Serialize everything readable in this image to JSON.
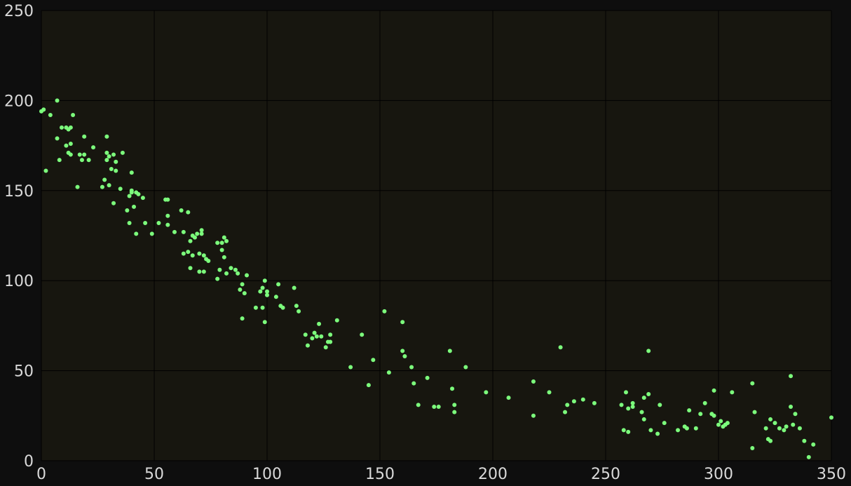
{
  "chart_data": {
    "type": "scatter",
    "title": "",
    "xlabel": "",
    "ylabel": "",
    "xlim": [
      0,
      350
    ],
    "ylim": [
      0,
      250
    ],
    "xticks": [
      0,
      50,
      100,
      150,
      200,
      250,
      300,
      350
    ],
    "yticks": [
      0,
      50,
      100,
      150,
      200,
      250
    ],
    "grid": true,
    "colors": {
      "page_background": "#0e0e0e",
      "plot_background": "#17160f",
      "grid": "#000000",
      "points": "#7cfc7c",
      "tick_labels": "#d9d9d9"
    },
    "series": [
      {
        "points": [
          [
            0,
            194
          ],
          [
            1,
            195
          ],
          [
            2,
            161
          ],
          [
            4,
            192
          ],
          [
            7,
            179
          ],
          [
            7,
            200
          ],
          [
            8,
            167
          ],
          [
            9,
            185
          ],
          [
            11,
            185
          ],
          [
            11,
            175
          ],
          [
            12,
            184
          ],
          [
            12,
            171
          ],
          [
            13,
            176
          ],
          [
            13,
            170
          ],
          [
            13,
            185
          ],
          [
            14,
            192
          ],
          [
            16,
            152
          ],
          [
            17,
            170
          ],
          [
            18,
            167
          ],
          [
            19,
            170
          ],
          [
            19,
            180
          ],
          [
            21,
            167
          ],
          [
            23,
            174
          ],
          [
            27,
            152
          ],
          [
            28,
            156
          ],
          [
            29,
            171
          ],
          [
            29,
            180
          ],
          [
            29,
            167
          ],
          [
            30,
            169
          ],
          [
            30,
            153
          ],
          [
            31,
            162
          ],
          [
            32,
            143
          ],
          [
            32,
            170
          ],
          [
            33,
            161
          ],
          [
            33,
            166
          ],
          [
            35,
            151
          ],
          [
            36,
            171
          ],
          [
            38,
            139
          ],
          [
            39,
            132
          ],
          [
            39,
            147
          ],
          [
            40,
            149
          ],
          [
            40,
            160
          ],
          [
            40,
            150
          ],
          [
            41,
            141
          ],
          [
            42,
            126
          ],
          [
            42,
            149
          ],
          [
            43,
            148
          ],
          [
            45,
            146
          ],
          [
            46,
            132
          ],
          [
            49,
            126
          ],
          [
            52,
            132
          ],
          [
            55,
            145
          ],
          [
            56,
            145
          ],
          [
            56,
            136
          ],
          [
            56,
            131
          ],
          [
            59,
            127
          ],
          [
            62,
            139
          ],
          [
            63,
            127
          ],
          [
            63,
            115
          ],
          [
            65,
            138
          ],
          [
            65,
            116
          ],
          [
            66,
            107
          ],
          [
            66,
            122
          ],
          [
            67,
            125
          ],
          [
            67,
            114
          ],
          [
            68,
            124
          ],
          [
            69,
            126
          ],
          [
            70,
            115
          ],
          [
            70,
            105
          ],
          [
            71,
            128
          ],
          [
            71,
            126
          ],
          [
            72,
            105
          ],
          [
            72,
            114
          ],
          [
            73,
            112
          ],
          [
            74,
            111
          ],
          [
            78,
            101
          ],
          [
            78,
            121
          ],
          [
            79,
            106
          ],
          [
            80,
            121
          ],
          [
            80,
            117
          ],
          [
            81,
            124
          ],
          [
            81,
            113
          ],
          [
            82,
            122
          ],
          [
            82,
            104
          ],
          [
            84,
            107
          ],
          [
            86,
            106
          ],
          [
            87,
            104
          ],
          [
            88,
            95
          ],
          [
            89,
            79
          ],
          [
            89,
            98
          ],
          [
            90,
            93
          ],
          [
            91,
            103
          ],
          [
            95,
            85
          ],
          [
            97,
            94
          ],
          [
            98,
            85
          ],
          [
            98,
            96
          ],
          [
            99,
            100
          ],
          [
            99,
            77
          ],
          [
            100,
            94
          ],
          [
            100,
            92
          ],
          [
            104,
            91
          ],
          [
            105,
            98
          ],
          [
            106,
            86
          ],
          [
            107,
            85
          ],
          [
            112,
            96
          ],
          [
            113,
            86
          ],
          [
            114,
            83
          ],
          [
            117,
            70
          ],
          [
            118,
            64
          ],
          [
            120,
            68
          ],
          [
            121,
            71
          ],
          [
            122,
            69
          ],
          [
            123,
            76
          ],
          [
            124,
            69
          ],
          [
            126,
            63
          ],
          [
            127,
            66
          ],
          [
            128,
            70
          ],
          [
            128,
            66
          ],
          [
            131,
            78
          ],
          [
            137,
            52
          ],
          [
            142,
            70
          ],
          [
            145,
            42
          ],
          [
            147,
            56
          ],
          [
            152,
            83
          ],
          [
            154,
            49
          ],
          [
            160,
            77
          ],
          [
            160,
            61
          ],
          [
            161,
            58
          ],
          [
            164,
            52
          ],
          [
            165,
            43
          ],
          [
            167,
            31
          ],
          [
            171,
            46
          ],
          [
            174,
            30
          ],
          [
            176,
            30
          ],
          [
            181,
            61
          ],
          [
            182,
            40
          ],
          [
            183,
            31
          ],
          [
            183,
            27
          ],
          [
            188,
            52
          ],
          [
            197,
            38
          ],
          [
            207,
            35
          ],
          [
            218,
            44
          ],
          [
            218,
            25
          ],
          [
            225,
            38
          ],
          [
            230,
            63
          ],
          [
            232,
            27
          ],
          [
            233,
            31
          ],
          [
            236,
            33
          ],
          [
            240,
            34
          ],
          [
            245,
            32
          ],
          [
            257,
            31
          ],
          [
            258,
            17
          ],
          [
            259,
            38
          ],
          [
            260,
            29
          ],
          [
            260,
            16
          ],
          [
            262,
            32
          ],
          [
            262,
            30
          ],
          [
            266,
            27
          ],
          [
            267,
            35
          ],
          [
            267,
            23
          ],
          [
            269,
            61
          ],
          [
            269,
            37
          ],
          [
            270,
            17
          ],
          [
            273,
            15
          ],
          [
            274,
            31
          ],
          [
            276,
            21
          ],
          [
            282,
            17
          ],
          [
            285,
            19
          ],
          [
            286,
            18
          ],
          [
            287,
            28
          ],
          [
            290,
            18
          ],
          [
            292,
            26
          ],
          [
            294,
            32
          ],
          [
            297,
            26
          ],
          [
            298,
            25
          ],
          [
            298,
            39
          ],
          [
            300,
            20
          ],
          [
            301,
            22
          ],
          [
            302,
            19
          ],
          [
            303,
            20
          ],
          [
            304,
            21
          ],
          [
            306,
            38
          ],
          [
            315,
            43
          ],
          [
            315,
            7
          ],
          [
            316,
            27
          ],
          [
            321,
            18
          ],
          [
            322,
            12
          ],
          [
            323,
            11
          ],
          [
            323,
            23
          ],
          [
            325,
            21
          ],
          [
            327,
            18
          ],
          [
            329,
            17
          ],
          [
            330,
            19
          ],
          [
            332,
            47
          ],
          [
            332,
            30
          ],
          [
            333,
            20
          ],
          [
            334,
            26
          ],
          [
            336,
            18
          ],
          [
            338,
            11
          ],
          [
            340,
            2
          ],
          [
            342,
            9
          ],
          [
            350,
            24
          ]
        ]
      }
    ]
  }
}
